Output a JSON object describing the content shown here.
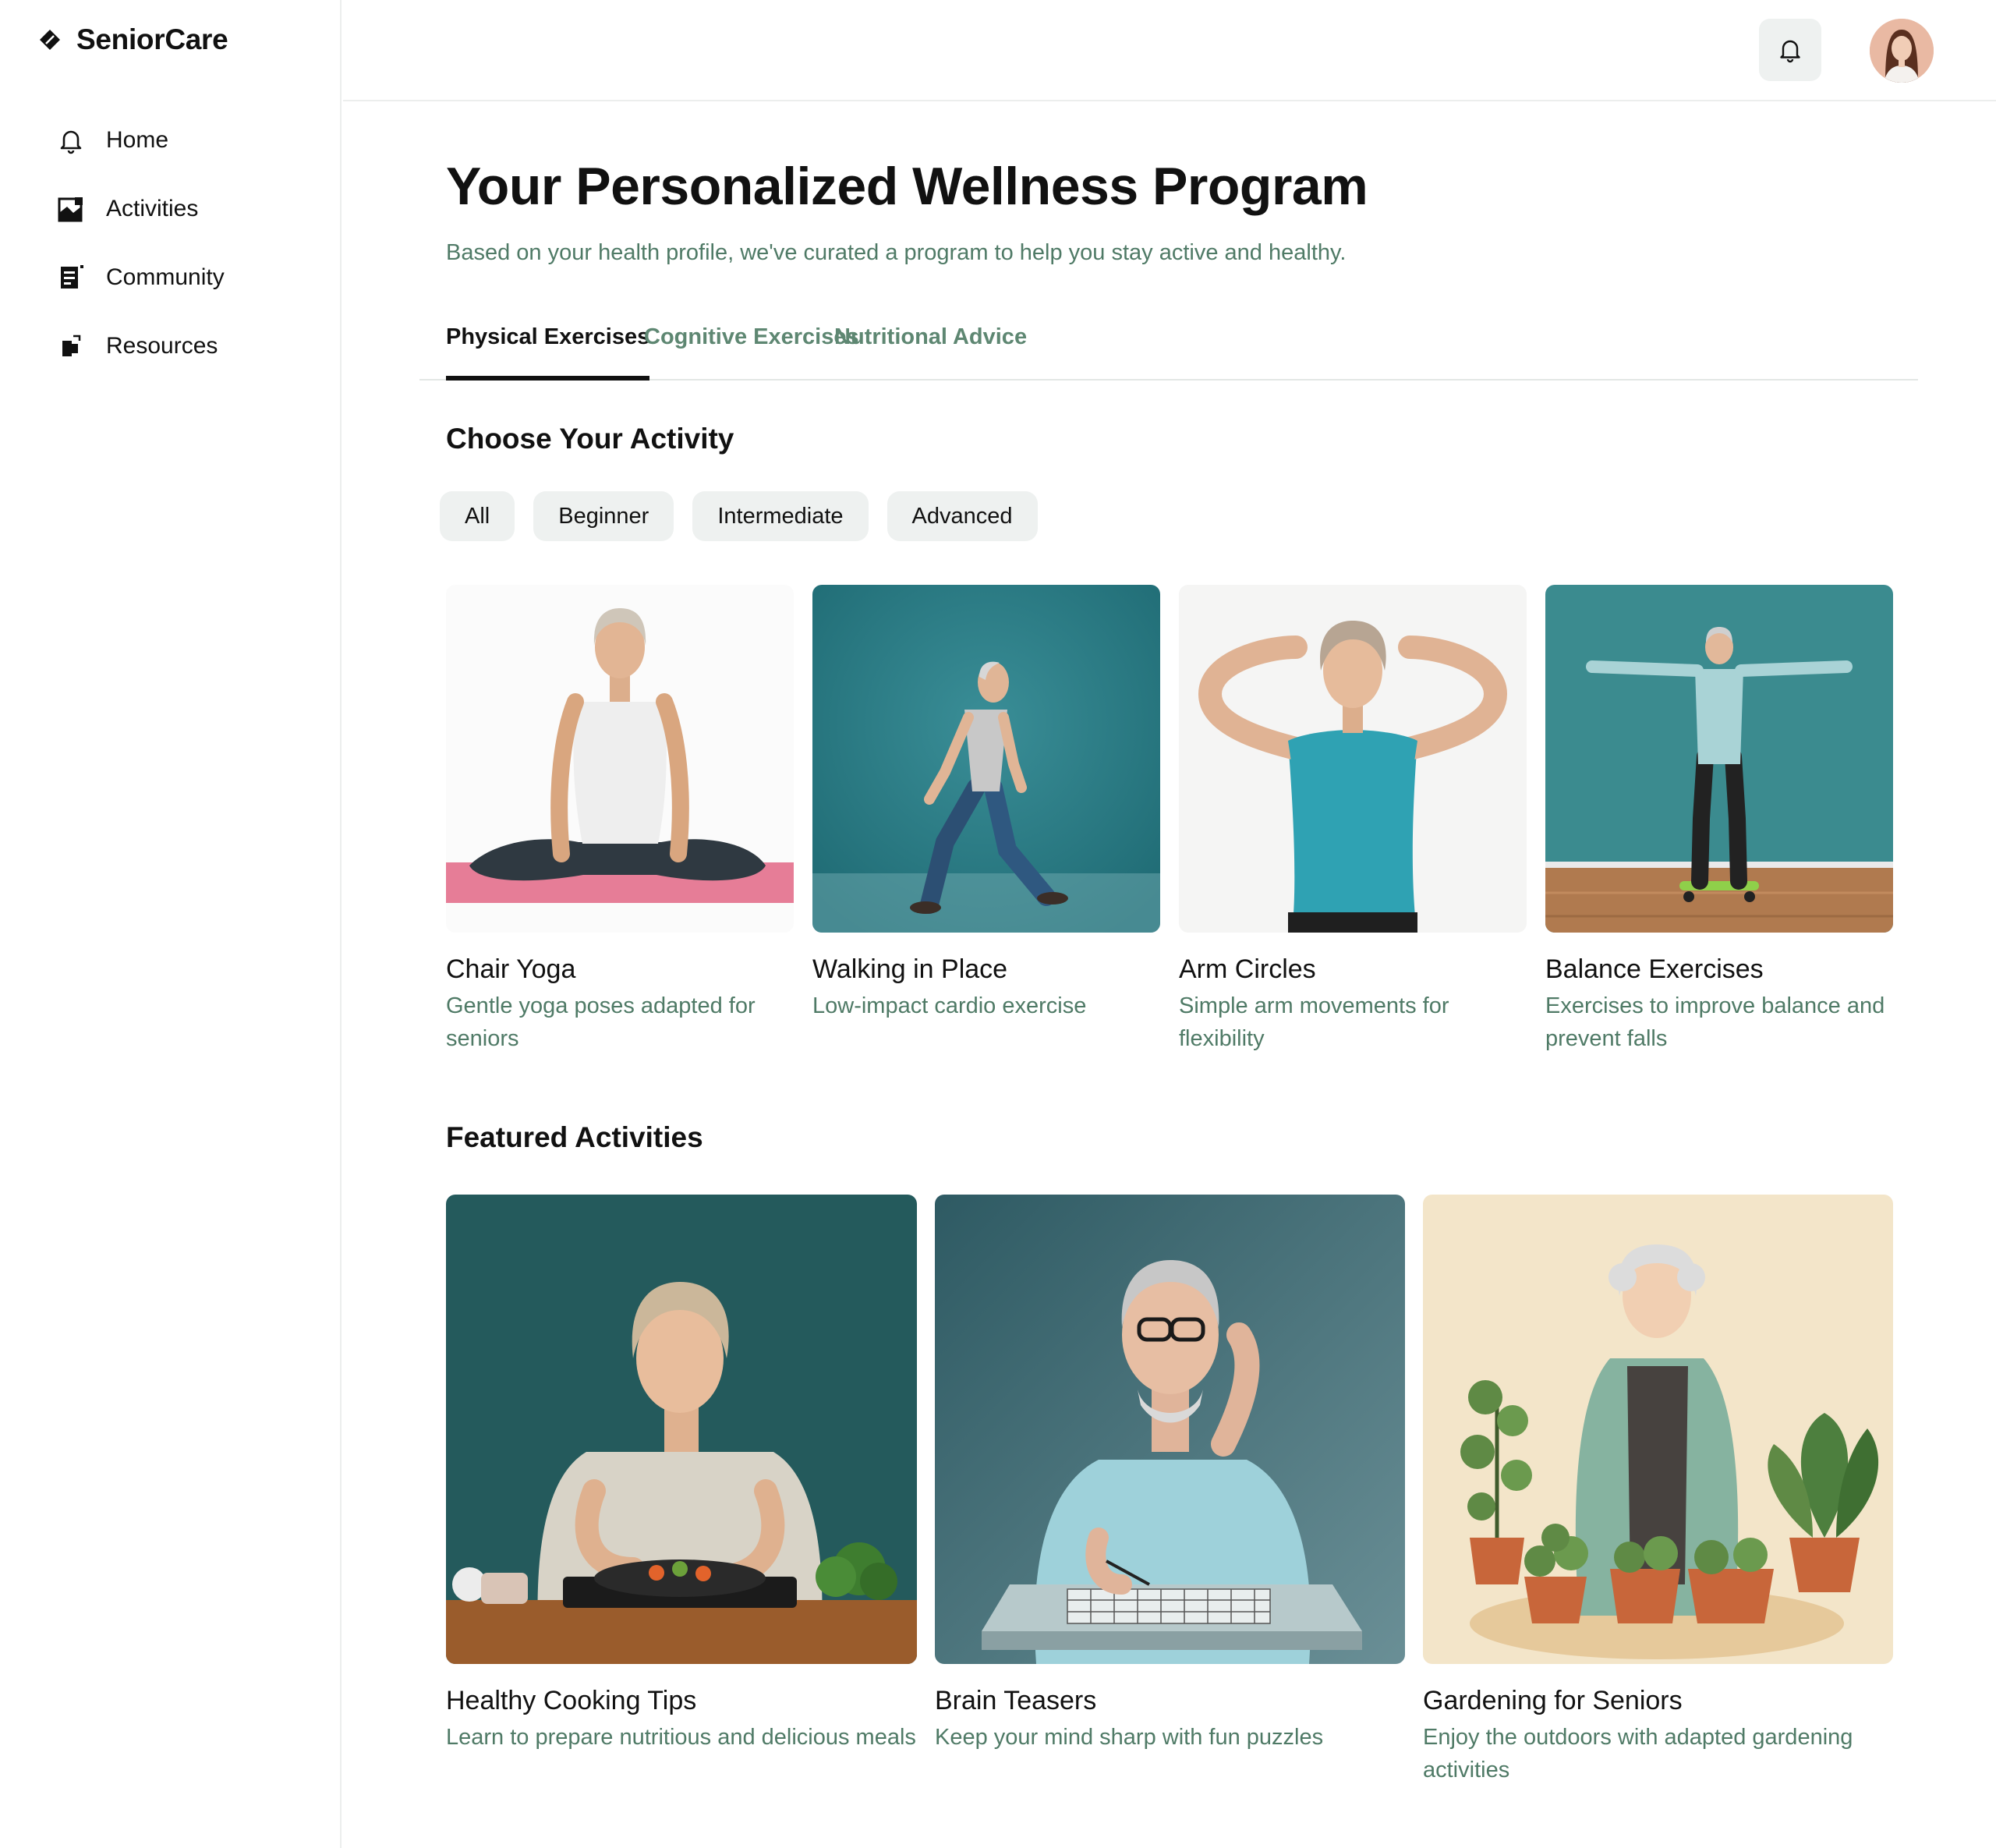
{
  "app": {
    "name": "SeniorCare"
  },
  "sidebar": {
    "items": [
      {
        "label": "Home",
        "icon": "bell-icon"
      },
      {
        "label": "Activities",
        "icon": "activities-icon"
      },
      {
        "label": "Community",
        "icon": "community-icon"
      },
      {
        "label": "Resources",
        "icon": "resources-icon"
      }
    ]
  },
  "header": {
    "notifications_icon": "bell-icon",
    "avatar": "user-avatar"
  },
  "main": {
    "title": "Your Personalized Wellness Program",
    "subtitle": "Based on your health profile, we've curated a program to help you stay active and healthy.",
    "tabs": [
      {
        "label": "Physical Exercises",
        "active": true
      },
      {
        "label": "Cognitive Exercises",
        "active": false
      },
      {
        "label": "Nutritional Advice",
        "active": false
      }
    ],
    "choose_title": "Choose Your Activity",
    "filters": [
      "All",
      "Beginner",
      "Intermediate",
      "Advanced"
    ],
    "activities": [
      {
        "title": "Chair Yoga",
        "description": "Gentle yoga poses adapted for seniors"
      },
      {
        "title": "Walking in Place",
        "description": "Low-impact cardio exercise"
      },
      {
        "title": "Arm Circles",
        "description": "Simple arm movements for flexibility"
      },
      {
        "title": "Balance Exercises",
        "description": "Exercises to improve balance and prevent falls"
      }
    ],
    "featured_title": "Featured Activities",
    "featured": [
      {
        "title": "Healthy Cooking Tips",
        "description": "Learn to prepare nutritious and delicious meals"
      },
      {
        "title": "Brain Teasers",
        "description": "Keep your mind sharp with fun puzzles"
      },
      {
        "title": "Gardening for Seniors",
        "description": "Enjoy the outdoors with adapted gardening activities"
      }
    ]
  },
  "colors": {
    "accent_text": "#4f7a66",
    "chip_bg": "#eef1f0",
    "teal": "#2d7f86"
  }
}
